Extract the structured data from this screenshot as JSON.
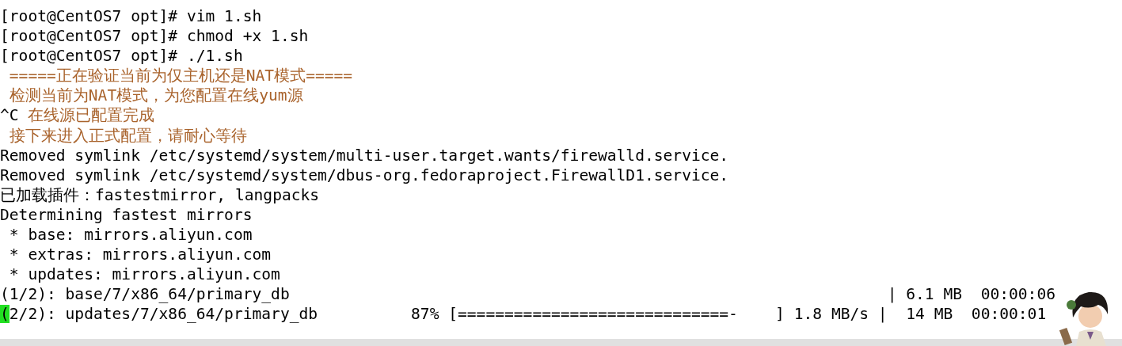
{
  "terminal": {
    "lines": [
      {
        "segments": [
          {
            "kind": "plain",
            "text": "[root@CentOS7 opt]# vim 1.sh"
          }
        ]
      },
      {
        "segments": [
          {
            "kind": "plain",
            "text": "[root@CentOS7 opt]# chmod +x 1.sh"
          }
        ]
      },
      {
        "segments": [
          {
            "kind": "plain",
            "text": "[root@CentOS7 opt]# ./1.sh"
          }
        ]
      },
      {
        "segments": [
          {
            "kind": "notice",
            "text": " =====正在验证当前为仅主机还是NAT模式====="
          }
        ]
      },
      {
        "segments": [
          {
            "kind": "notice",
            "text": " 检测当前为NAT模式，为您配置在线yum源"
          }
        ]
      },
      {
        "segments": [
          {
            "kind": "plain",
            "text": "^C"
          },
          {
            "kind": "notice",
            "text": " 在线源已配置完成"
          }
        ]
      },
      {
        "segments": [
          {
            "kind": "notice",
            "text": " 接下来进入正式配置，请耐心等待"
          }
        ]
      },
      {
        "segments": [
          {
            "kind": "plain",
            "text": "Removed symlink /etc/systemd/system/multi-user.target.wants/firewalld.service."
          }
        ]
      },
      {
        "segments": [
          {
            "kind": "plain",
            "text": "Removed symlink /etc/systemd/system/dbus-org.fedoraproject.FirewallD1.service."
          }
        ]
      },
      {
        "segments": [
          {
            "kind": "plain",
            "text": "已加载插件：fastestmirror, langpacks"
          }
        ]
      },
      {
        "segments": [
          {
            "kind": "plain",
            "text": "Determining fastest mirrors"
          }
        ]
      },
      {
        "segments": [
          {
            "kind": "plain",
            "text": " * base: mirrors.aliyun.com"
          }
        ]
      },
      {
        "segments": [
          {
            "kind": "plain",
            "text": " * extras: mirrors.aliyun.com"
          }
        ]
      },
      {
        "segments": [
          {
            "kind": "plain",
            "text": " * updates: mirrors.aliyun.com"
          }
        ]
      },
      {
        "segments": [
          {
            "kind": "plain",
            "text": "(1/2): base/7/x86_64/primary_db                                                                | 6.1 MB  00:00:06"
          }
        ]
      },
      {
        "segments": [
          {
            "kind": "cursor",
            "text": "("
          },
          {
            "kind": "plain",
            "text": "2/2): updates/7/x86_64/primary_db          87% [=============================-    ] 1.8 MB/s |  14 MB  00:00:01"
          }
        ]
      }
    ]
  }
}
